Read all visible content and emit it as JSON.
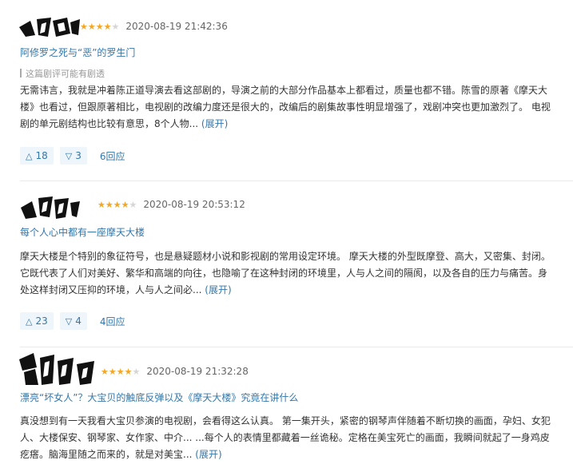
{
  "reviews": [
    {
      "rating": 4,
      "date": "2020-08-19 21:42:36",
      "title": "阿修罗之死与“恶”的罗生门",
      "spoiler": "这篇剧评可能有剧透",
      "body": "无需讳言，我就是冲着陈正道导演去看这部剧的，导演之前的大部分作品基本上都看过，质量也都不错。陈雪的原著《摩天大楼》也看过，但跟原著相比，电视剧的改编力度还是很大的，改编后的剧集故事性明显增强了，戏剧冲突也更加激烈了。 电视剧的单元剧结构也比较有意思，8个人物...",
      "expand": "(展开)",
      "up": "18",
      "down": "3",
      "replies": "6回应"
    },
    {
      "rating": 4,
      "date": "2020-08-19 20:53:12",
      "title": "每个人心中都有一座摩天大楼",
      "body": "摩天大楼是个特别的象征符号，也是悬疑题材小说和影视剧的常用设定环境。 摩天大楼的外型既摩登、高大，又密集、封闭。它既代表了人们对美好、繁华和高端的向往，也隐喻了在这种封闭的环境里，人与人之间的隔阂，以及各自的压力与痛苦。身处这样封闭又压抑的环境，人与人之间必...",
      "expand": "(展开)",
      "up": "23",
      "down": "4",
      "replies": "4回应"
    },
    {
      "rating": 4,
      "date": "2020-08-19 21:32:28",
      "title": "漂亮“坏女人”？大宝贝的触底反弹以及《摩天大楼》究竟在讲什么",
      "body": "真没想到有一天我看大宝贝参演的电视剧，会看得这么认真。 第一集开头，紧密的钢琴声伴随着不断切换的画面，孕妇、女犯人、大楼保安、钢琴家、女作家、中介... ...每个人的表情里都藏着一丝诡秘。定格在美宝死亡的画面，我瞬间就起了一身鸡皮疙瘩。脑海里随之而来的，就是对美宝...",
      "expand": "(展开)"
    }
  ],
  "colors": {
    "link": "#3377aa",
    "star": "#f5a623",
    "vote_bg": "#eef5fb"
  },
  "icons": {
    "up": "up-triangle-icon",
    "down": "down-triangle-icon"
  }
}
